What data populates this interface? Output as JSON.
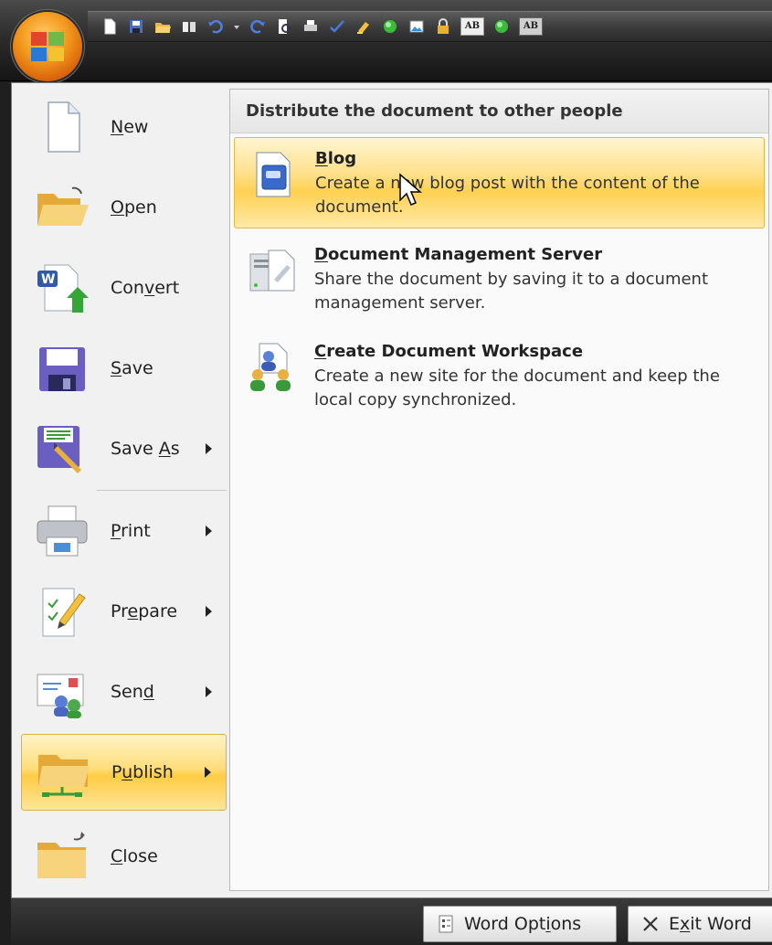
{
  "office_button": {
    "icon": "office-logo-icon"
  },
  "quick_access": {
    "buttons": [
      {
        "icon": "new-doc-icon"
      },
      {
        "icon": "save-icon"
      },
      {
        "icon": "open-folder-icon"
      },
      {
        "icon": "book-icon"
      },
      {
        "icon": "undo-icon"
      },
      {
        "icon": "dropdown-icon"
      },
      {
        "icon": "redo-icon"
      },
      {
        "icon": "print-preview-icon"
      },
      {
        "icon": "quick-print-icon"
      },
      {
        "icon": "spelling-icon"
      },
      {
        "icon": "highlight-icon"
      },
      {
        "icon": "green-circle-icon"
      },
      {
        "icon": "insert-picture-icon"
      },
      {
        "icon": "lock-icon"
      },
      {
        "icon": "text-box-icon",
        "label": "AB"
      },
      {
        "icon": "green-circle-icon"
      },
      {
        "icon": "text-box-icon",
        "label": "AB"
      }
    ]
  },
  "menu": {
    "commands": [
      {
        "label_pre": "",
        "label_key": "N",
        "label_post": "ew",
        "icon": "new-document-icon",
        "has_submenu": false
      },
      {
        "label_pre": "",
        "label_key": "O",
        "label_post": "pen",
        "icon": "open-folder-icon",
        "has_submenu": false
      },
      {
        "label_pre": "Con",
        "label_key": "v",
        "label_post": "ert",
        "icon": "convert-icon",
        "has_submenu": false
      },
      {
        "label_pre": "",
        "label_key": "S",
        "label_post": "ave",
        "icon": "save-icon",
        "has_submenu": false
      },
      {
        "label_pre": "Save ",
        "label_key": "A",
        "label_post": "s",
        "icon": "save-as-icon",
        "has_submenu": true
      },
      {
        "label_pre": "",
        "label_key": "P",
        "label_post": "rint",
        "icon": "printer-icon",
        "has_submenu": true
      },
      {
        "label_pre": "Pr",
        "label_key": "e",
        "label_post": "pare",
        "icon": "prepare-icon",
        "has_submenu": true
      },
      {
        "label_pre": "Sen",
        "label_key": "d",
        "label_post": "",
        "icon": "send-icon",
        "has_submenu": true
      },
      {
        "label_pre": "P",
        "label_key": "u",
        "label_post": "blish",
        "icon": "publish-icon",
        "has_submenu": true,
        "active": true
      },
      {
        "label_pre": "",
        "label_key": "C",
        "label_post": "lose",
        "icon": "close-folder-icon",
        "has_submenu": false
      }
    ]
  },
  "panel": {
    "header": "Distribute the document to other people",
    "items": [
      {
        "title_key": "B",
        "title_rest": "log",
        "description": "Create a new blog post with the content of the document.",
        "icon": "blog-icon",
        "active": true
      },
      {
        "title_key": "D",
        "title_rest": "ocument Management Server",
        "description": "Share the document by saving it to a document management server.",
        "icon": "document-server-icon",
        "active": false
      },
      {
        "title_key": "C",
        "title_rest": "reate Document Workspace",
        "description": "Create a new site for the document and keep the local copy synchronized.",
        "icon": "workspace-icon",
        "active": false
      }
    ]
  },
  "footer": {
    "options_pre": "Word Opt",
    "options_key": "i",
    "options_post": "ons",
    "exit_pre": "E",
    "exit_key": "x",
    "exit_post": "it Word"
  },
  "colors": {
    "highlight_top": "#fff3c8",
    "highlight_mid": "#ffcc44",
    "menu_bg": "#f1f1f1",
    "frame_dark": "#2d2d2d"
  }
}
